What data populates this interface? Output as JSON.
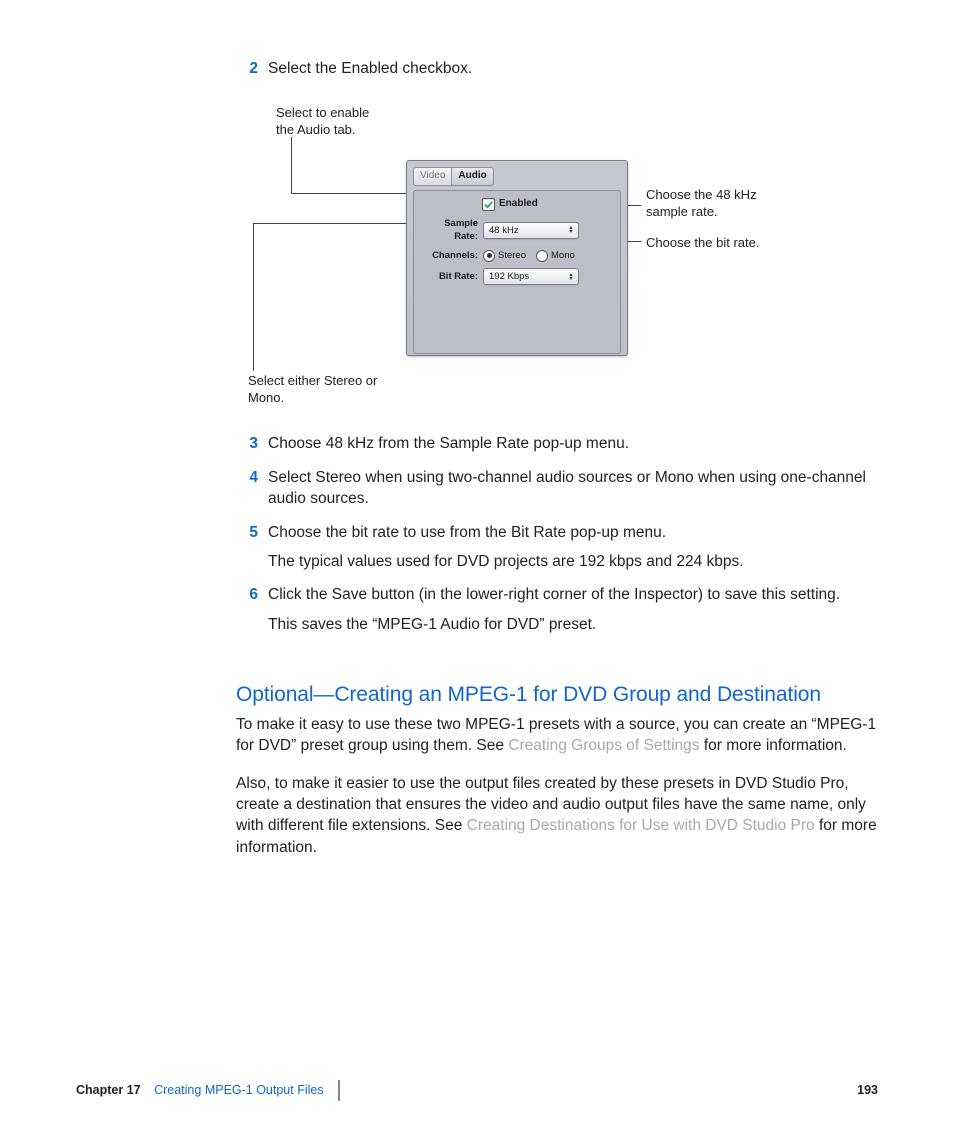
{
  "steps": {
    "s2": {
      "num": "2",
      "text": "Select the Enabled checkbox."
    },
    "s3": {
      "num": "3",
      "text": "Choose 48 kHz from the Sample Rate pop-up menu."
    },
    "s4": {
      "num": "4",
      "text": "Select Stereo when using two-channel audio sources or Mono when using one-channel audio sources."
    },
    "s5": {
      "num": "5",
      "text": "Choose the bit rate to use from the Bit Rate pop-up menu.",
      "note": "The typical values used for DVD projects are 192 kbps and 224 kbps."
    },
    "s6": {
      "num": "6",
      "text": "Click the Save button (in the lower-right corner of the Inspector) to save this setting.",
      "note": "This saves the “MPEG-1 Audio for DVD” preset."
    }
  },
  "screenshot": {
    "tabs": {
      "video": "Video",
      "audio": "Audio"
    },
    "enabled_label": "Enabled",
    "sample_rate_label": "Sample Rate:",
    "sample_rate_value": "48 kHz",
    "channels_label": "Channels:",
    "stereo": "Stereo",
    "mono": "Mono",
    "bit_rate_label": "Bit Rate:",
    "bit_rate_value": "192 Kbps"
  },
  "callouts": {
    "enable": "Select to enable the Audio tab.",
    "sample": "Choose the 48 kHz sample rate.",
    "bitrate": "Choose the bit rate.",
    "channels": "Select either Stereo or Mono."
  },
  "section": {
    "heading": "Optional—Creating an MPEG-1 for DVD Group and Destination",
    "p1a": "To make it easy to use these two MPEG-1 presets with a source, you can create an “MPEG-1 for DVD” preset group using them. See ",
    "p1link": "Creating Groups of Settings",
    "p1b": " for more information.",
    "p2a": "Also, to make it easier to use the output files created by these presets in DVD Studio Pro, create a destination that ensures the video and audio output files have the same name, only with different file extensions. See ",
    "p2link": "Creating Destinations for Use with DVD Studio Pro",
    "p2b": " for more information."
  },
  "footer": {
    "chapter": "Chapter 17",
    "title": "Creating MPEG-1 Output Files",
    "page": "193"
  }
}
